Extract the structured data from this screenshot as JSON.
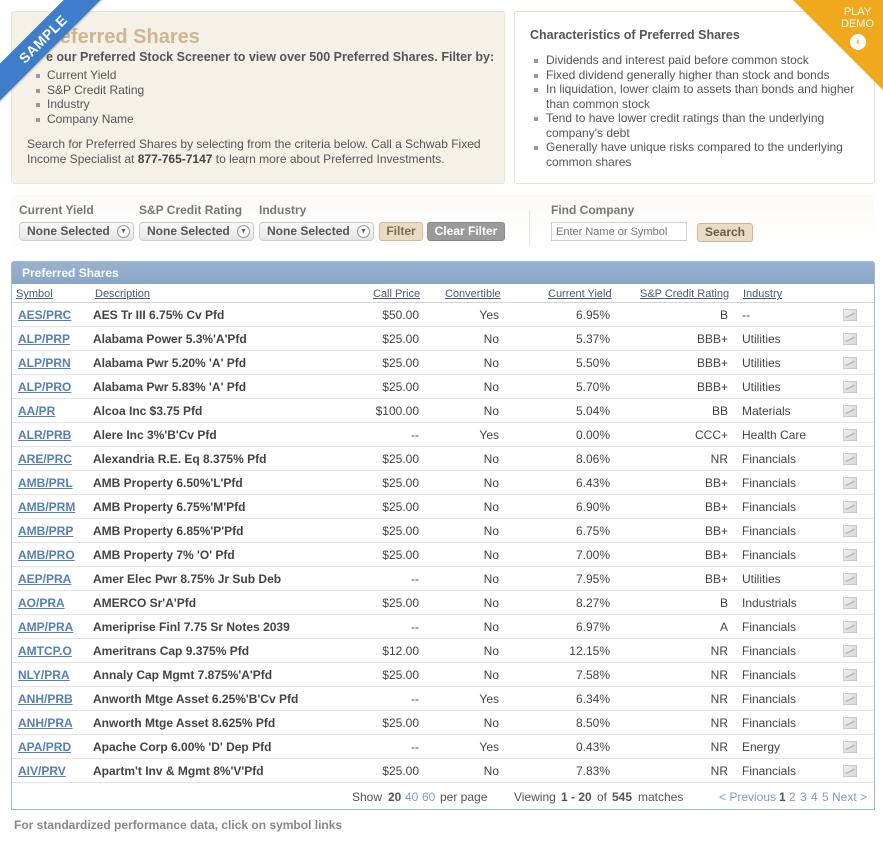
{
  "ribbon": {
    "label": "SAMPLE"
  },
  "demo": {
    "line1": "PLAY",
    "line2": "DEMO",
    "arrow": "‹"
  },
  "intro": {
    "title": "referred Shares",
    "lead": "e our Preferred Stock Screener to view over 500 Preferred Shares. Filter by:",
    "filters": [
      "Current Yield",
      "S&P Credit Rating",
      "Industry",
      "Company Name"
    ],
    "foot_text": "Search for Preferred Shares by selecting from the criteria below. Call a Schwab Fixed Income Specialist at ",
    "phone": "877-765-7147",
    "foot_tail": " to learn more about Preferred Investments."
  },
  "characteristics": {
    "title": "Characteristics of Preferred Shares",
    "items": [
      "Dividends and interest paid before common stock",
      "Fixed dividend generally higher than stock and bonds",
      "In liquidation, lower claim to assets than bonds and higher than common stock",
      "Tend to have lower credit ratings than the underlying company's debt",
      "Generally have unique risks compared to the underlying common shares"
    ]
  },
  "filter_bar": {
    "yield_label": "Current Yield",
    "yield_value": "None Selected",
    "rating_label": "S&P Credit Rating",
    "rating_value": "None Selected",
    "industry_label": "Industry",
    "industry_value": "None Selected",
    "filter_button": "Filter",
    "clear_button": "Clear Filter",
    "find_label": "Find Company",
    "find_placeholder": "Enter Name or Symbol",
    "search_button": "Search"
  },
  "table": {
    "title": "Preferred Shares",
    "headers": {
      "symbol": "Symbol",
      "description": "Description",
      "call_price": "Call Price",
      "convertible": "Convertible",
      "current_yield": "Current Yield",
      "rating": "S&P Credit Rating",
      "industry": "Industry"
    },
    "rows": [
      {
        "symbol": "AES/PRC",
        "description": "AES Tr III 6.75% Cv Pfd",
        "call": "$50.00",
        "conv": "Yes",
        "yield": "6.95%",
        "rating": "B",
        "industry": "--"
      },
      {
        "symbol": "ALP/PRP",
        "description": "Alabama Power 5.3%'A'Pfd",
        "call": "$25.00",
        "conv": "No",
        "yield": "5.37%",
        "rating": "BBB+",
        "industry": "Utilities"
      },
      {
        "symbol": "ALP/PRN",
        "description": "Alabama Pwr 5.20% 'A' Pfd",
        "call": "$25.00",
        "conv": "No",
        "yield": "5.50%",
        "rating": "BBB+",
        "industry": "Utilities"
      },
      {
        "symbol": "ALP/PRO",
        "description": "Alabama Pwr 5.83% 'A' Pfd",
        "call": "$25.00",
        "conv": "No",
        "yield": "5.70%",
        "rating": "BBB+",
        "industry": "Utilities"
      },
      {
        "symbol": "AA/PR",
        "description": "Alcoa Inc $3.75 Pfd",
        "call": "$100.00",
        "conv": "No",
        "yield": "5.04%",
        "rating": "BB",
        "industry": "Materials"
      },
      {
        "symbol": "ALR/PRB",
        "description": "Alere Inc 3%'B'Cv Pfd",
        "call": "--",
        "conv": "Yes",
        "yield": "0.00%",
        "rating": "CCC+",
        "industry": "Health Care"
      },
      {
        "symbol": "ARE/PRC",
        "description": "Alexandria R.E. Eq 8.375% Pfd",
        "call": "$25.00",
        "conv": "No",
        "yield": "8.06%",
        "rating": "NR",
        "industry": "Financials"
      },
      {
        "symbol": "AMB/PRL",
        "description": "AMB Property 6.50%'L'Pfd",
        "call": "$25.00",
        "conv": "No",
        "yield": "6.43%",
        "rating": "BB+",
        "industry": "Financials"
      },
      {
        "symbol": "AMB/PRM",
        "description": "AMB Property 6.75%'M'Pfd",
        "call": "$25.00",
        "conv": "No",
        "yield": "6.90%",
        "rating": "BB+",
        "industry": "Financials"
      },
      {
        "symbol": "AMB/PRP",
        "description": "AMB Property 6.85%'P'Pfd",
        "call": "$25.00",
        "conv": "No",
        "yield": "6.75%",
        "rating": "BB+",
        "industry": "Financials"
      },
      {
        "symbol": "AMB/PRO",
        "description": "AMB Property 7% 'O' Pfd",
        "call": "$25.00",
        "conv": "No",
        "yield": "7.00%",
        "rating": "BB+",
        "industry": "Financials"
      },
      {
        "symbol": "AEP/PRA",
        "description": "Amer Elec Pwr 8.75% Jr Sub Deb",
        "call": "--",
        "conv": "No",
        "yield": "7.95%",
        "rating": "BB+",
        "industry": "Utilities"
      },
      {
        "symbol": "AO/PRA",
        "description": "AMERCO Sr'A'Pfd",
        "call": "$25.00",
        "conv": "No",
        "yield": "8.27%",
        "rating": "B",
        "industry": "Industrials"
      },
      {
        "symbol": "AMP/PRA",
        "description": "Ameriprise Finl 7.75 Sr Notes 2039",
        "call": "--",
        "conv": "No",
        "yield": "6.97%",
        "rating": "A",
        "industry": "Financials"
      },
      {
        "symbol": "AMTCP.O",
        "description": "Ameritrans Cap 9.375% Pfd",
        "call": "$12.00",
        "conv": "No",
        "yield": "12.15%",
        "rating": "NR",
        "industry": "Financials"
      },
      {
        "symbol": "NLY/PRA",
        "description": "Annaly Cap Mgmt 7.875%'A'Pfd",
        "call": "$25.00",
        "conv": "No",
        "yield": "7.58%",
        "rating": "NR",
        "industry": "Financials"
      },
      {
        "symbol": "ANH/PRB",
        "description": "Anworth Mtge Asset 6.25%'B'Cv Pfd",
        "call": "--",
        "conv": "Yes",
        "yield": "6.34%",
        "rating": "NR",
        "industry": "Financials"
      },
      {
        "symbol": "ANH/PRA",
        "description": "Anworth Mtge Asset 8.625% Pfd",
        "call": "$25.00",
        "conv": "No",
        "yield": "8.50%",
        "rating": "NR",
        "industry": "Financials"
      },
      {
        "symbol": "APA/PRD",
        "description": "Apache Corp 6.00% 'D' Dep Pfd",
        "call": "--",
        "conv": "Yes",
        "yield": "0.43%",
        "rating": "NR",
        "industry": "Energy"
      },
      {
        "symbol": "AIV/PRV",
        "description": "Apartm't Inv & Mgmt 8%'V'Pfd",
        "call": "$25.00",
        "conv": "No",
        "yield": "7.83%",
        "rating": "NR",
        "industry": "Financials"
      }
    ]
  },
  "pager": {
    "show_label": "Show",
    "size_current": "20",
    "size_40": "40",
    "size_60": "60",
    "per_page": "per page",
    "viewing_label": "Viewing",
    "range": "1 - 20",
    "of_label": "of",
    "total": "545",
    "matches_label": "matches",
    "prev": "< Previous",
    "page_current": "1",
    "pages": [
      "2",
      "3",
      "4",
      "5"
    ],
    "next": "Next >"
  },
  "footnote": "For standardized performance data, click on symbol links"
}
